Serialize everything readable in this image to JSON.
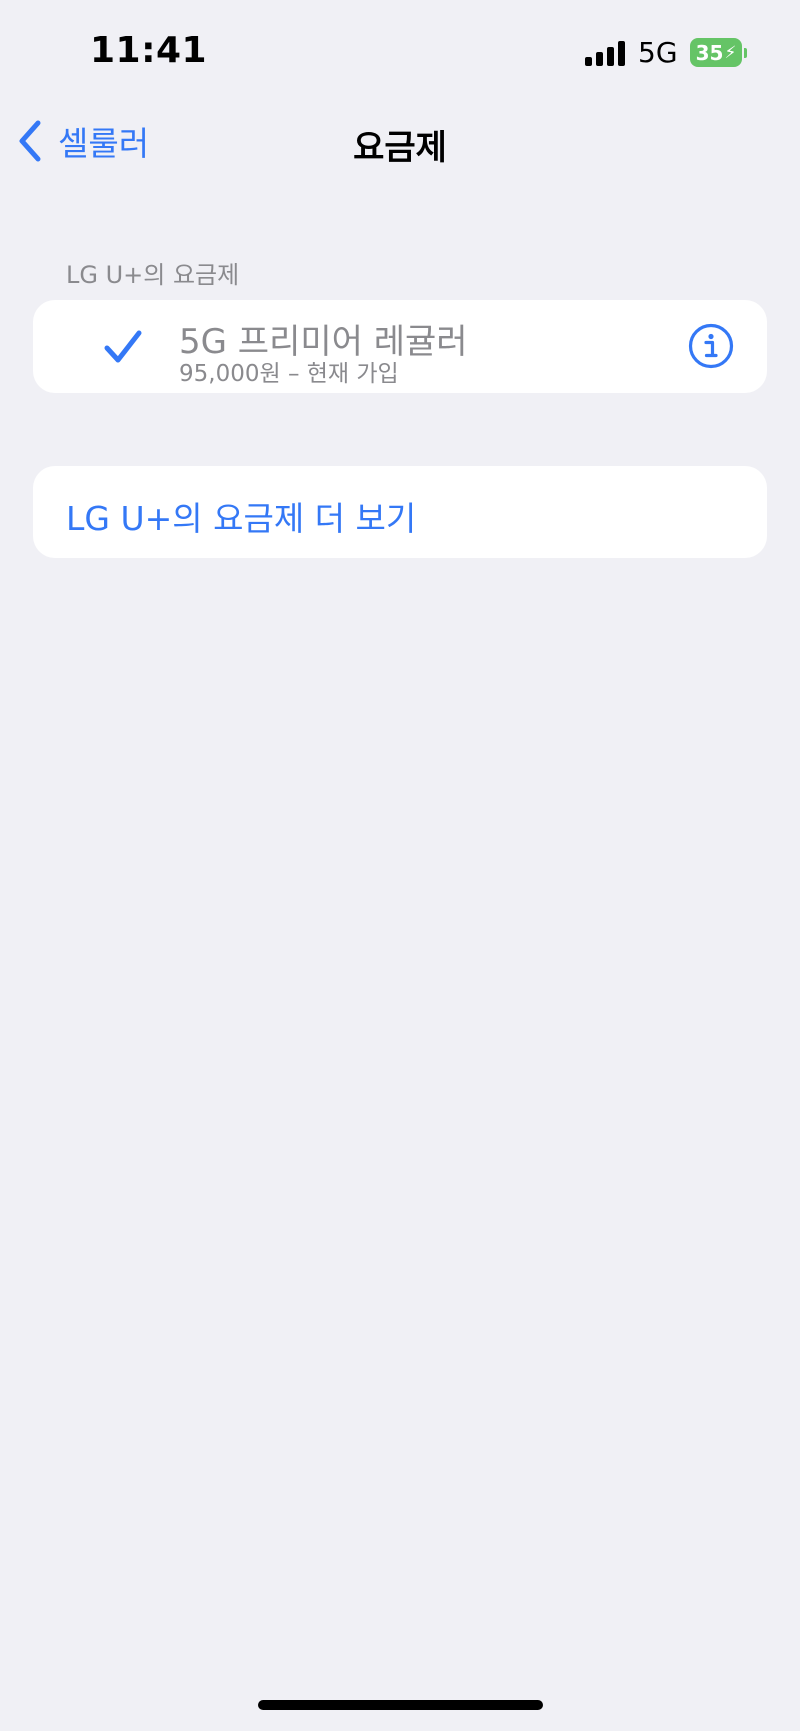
{
  "status_bar": {
    "time": "11:41",
    "network": "5G",
    "battery_level": "35",
    "battery_color": "#65c466",
    "signal_icon": "cellular-signal-icon",
    "battery_icon": "battery-charging-icon"
  },
  "nav": {
    "back_label": "셀룰러",
    "back_icon": "chevron-left-icon",
    "title": "요금제"
  },
  "section": {
    "header": "LG U+의 요금제"
  },
  "plans": [
    {
      "name": "5G 프리미어 레귤러",
      "detail": "95,000원 – 현재 가입",
      "selected": true,
      "check_icon": "checkmark-icon",
      "info_icon": "info-circle-icon"
    }
  ],
  "more": {
    "label": "LG U+의 요금제 더 보기"
  },
  "colors": {
    "accent": "#3478f6",
    "background": "#f0f0f5",
    "secondary_text": "#8a8a8e"
  }
}
